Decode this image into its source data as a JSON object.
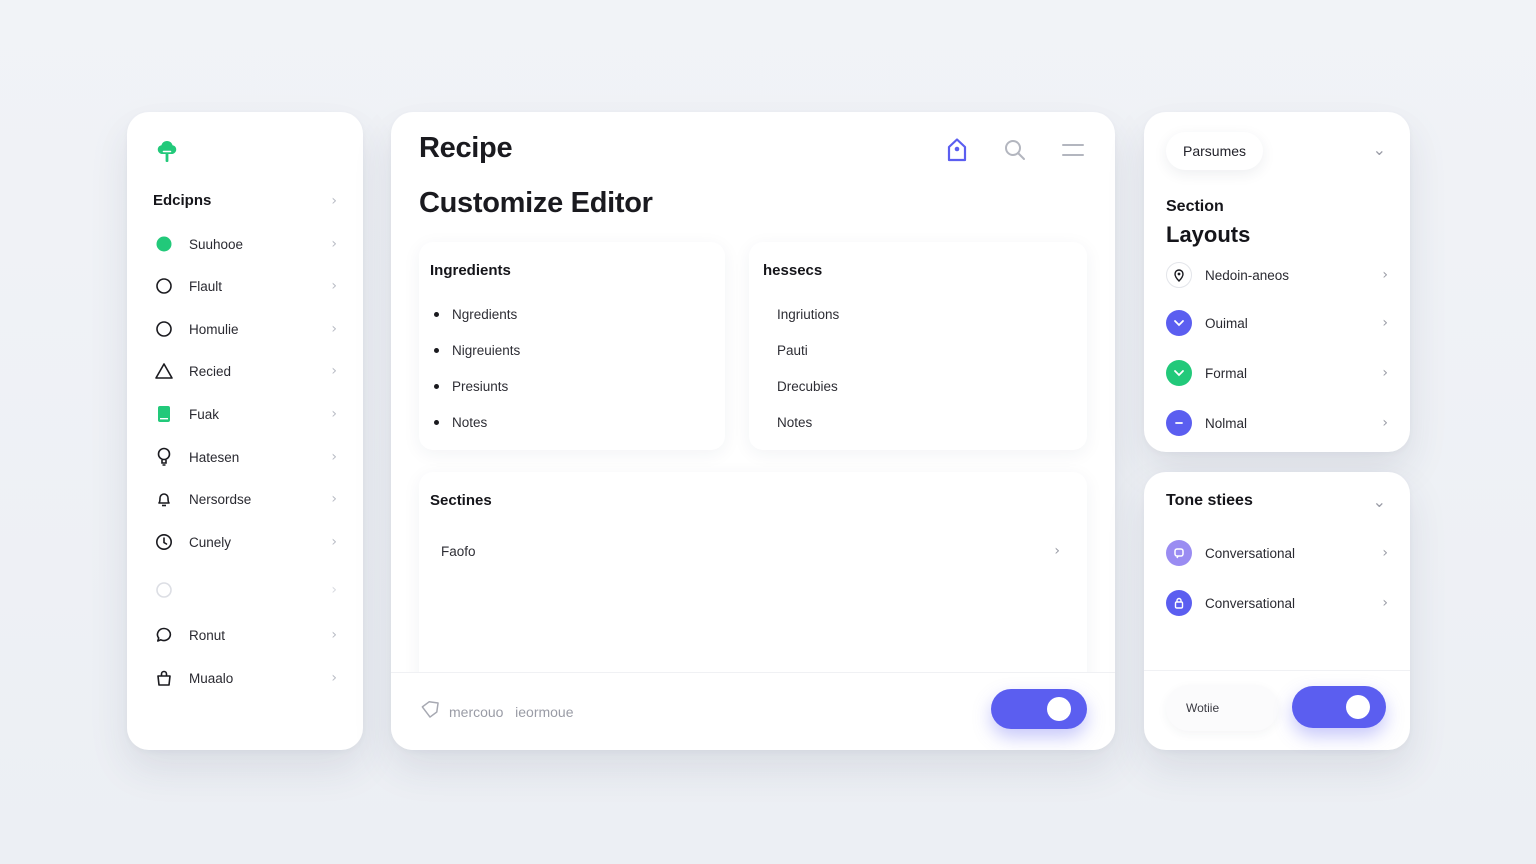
{
  "colors": {
    "accent": "#5b5ef0",
    "green": "#22c97a",
    "text": "#15151a"
  },
  "sidebar": {
    "title": "Edcipns",
    "items": [
      {
        "label": "Suuhooe",
        "icon": "green-dot-icon"
      },
      {
        "label": "Flault",
        "icon": "circle-icon"
      },
      {
        "label": "Homulie",
        "icon": "circle-icon"
      },
      {
        "label": "Recied",
        "icon": "triangle-icon"
      },
      {
        "label": "Fuak",
        "icon": "green-book-icon"
      },
      {
        "label": "Hatesen",
        "icon": "lightbulb-icon"
      },
      {
        "label": "Nersordse",
        "icon": "bell-icon"
      },
      {
        "label": "Cunely",
        "icon": "clock-icon"
      },
      {
        "label": "",
        "icon": "faded-circle-icon"
      },
      {
        "label": "Ronut",
        "icon": "chat-bubble-icon"
      },
      {
        "label": "Muaalo",
        "icon": "bag-icon"
      }
    ]
  },
  "main": {
    "title": "Recipe",
    "subtitle": "Customize Editor",
    "ingredients": {
      "title": "Ingredients",
      "items": [
        "Ngredients",
        "Nigreuients",
        "Presiunts",
        "Notes"
      ]
    },
    "hesecs": {
      "title": "hessecs",
      "items": [
        "Ingriutions",
        "Pauti",
        "Drecubies",
        "Notes"
      ]
    },
    "sections": {
      "title": "Sectines",
      "row_label": "Faofo"
    },
    "footer": {
      "left_text": "mercouo   ieormoue",
      "toggle_on": true
    }
  },
  "params": {
    "dropdown_label": "Parsumes",
    "section_small": "Section",
    "section_big": "Layouts",
    "items": [
      {
        "label": "Nedoin-aneos",
        "icon": "pin-icon"
      },
      {
        "label": "Ouimal",
        "icon": "purple-check-icon"
      },
      {
        "label": "Formal",
        "icon": "green-check-icon"
      },
      {
        "label": "Nolmal",
        "icon": "purple-dash-icon"
      }
    ]
  },
  "tone": {
    "title": "Tone stiees",
    "items": [
      {
        "label": "Conversational",
        "icon": "lavender-chat-icon"
      },
      {
        "label": "Conversational",
        "icon": "purple-lock-icon"
      }
    ],
    "footer_pill": "Wotiie",
    "toggle_on": true
  }
}
